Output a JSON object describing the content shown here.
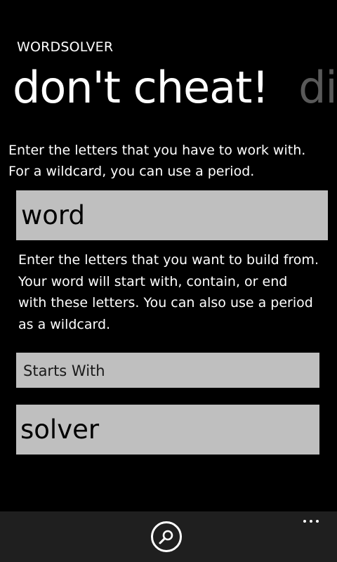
{
  "app": {
    "title": "WORDSOLVER"
  },
  "pivot": {
    "items": [
      {
        "label": "don't cheat!",
        "active": true
      },
      {
        "label": "dictionary",
        "active": false
      }
    ]
  },
  "form": {
    "intro_text": "Enter the letters that you have to work with.\nFor a wildcard, you can use a period.",
    "letters_value": "word",
    "build_text": "Enter the letters that you want to build from.\nYour word will start with, contain, or end\nwith these letters. You can also use a period\nas a wildcard.",
    "mode_selected": "Starts With",
    "fragment_value": "solver"
  },
  "app_bar": {
    "search_icon": "search-icon",
    "more_icon": "more-icon"
  },
  "colors": {
    "background": "#000000",
    "text": "#ffffff",
    "inactive_pivot": "#595959",
    "input_background": "#bfbfbf",
    "app_bar": "#1f1f1f"
  }
}
